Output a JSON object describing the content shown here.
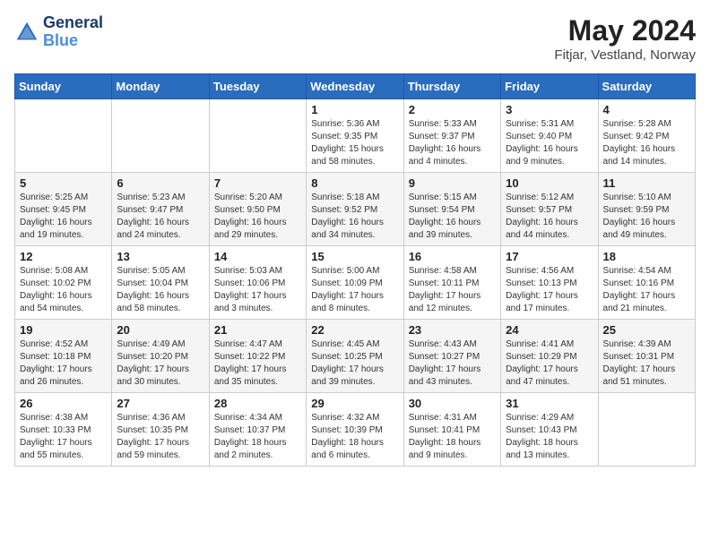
{
  "header": {
    "logo_line1": "General",
    "logo_line2": "Blue",
    "month_year": "May 2024",
    "location": "Fitjar, Vestland, Norway"
  },
  "weekdays": [
    "Sunday",
    "Monday",
    "Tuesday",
    "Wednesday",
    "Thursday",
    "Friday",
    "Saturday"
  ],
  "weeks": [
    [
      {
        "day": "",
        "info": ""
      },
      {
        "day": "",
        "info": ""
      },
      {
        "day": "",
        "info": ""
      },
      {
        "day": "1",
        "info": "Sunrise: 5:36 AM\nSunset: 9:35 PM\nDaylight: 15 hours\nand 58 minutes."
      },
      {
        "day": "2",
        "info": "Sunrise: 5:33 AM\nSunset: 9:37 PM\nDaylight: 16 hours\nand 4 minutes."
      },
      {
        "day": "3",
        "info": "Sunrise: 5:31 AM\nSunset: 9:40 PM\nDaylight: 16 hours\nand 9 minutes."
      },
      {
        "day": "4",
        "info": "Sunrise: 5:28 AM\nSunset: 9:42 PM\nDaylight: 16 hours\nand 14 minutes."
      }
    ],
    [
      {
        "day": "5",
        "info": "Sunrise: 5:25 AM\nSunset: 9:45 PM\nDaylight: 16 hours\nand 19 minutes."
      },
      {
        "day": "6",
        "info": "Sunrise: 5:23 AM\nSunset: 9:47 PM\nDaylight: 16 hours\nand 24 minutes."
      },
      {
        "day": "7",
        "info": "Sunrise: 5:20 AM\nSunset: 9:50 PM\nDaylight: 16 hours\nand 29 minutes."
      },
      {
        "day": "8",
        "info": "Sunrise: 5:18 AM\nSunset: 9:52 PM\nDaylight: 16 hours\nand 34 minutes."
      },
      {
        "day": "9",
        "info": "Sunrise: 5:15 AM\nSunset: 9:54 PM\nDaylight: 16 hours\nand 39 minutes."
      },
      {
        "day": "10",
        "info": "Sunrise: 5:12 AM\nSunset: 9:57 PM\nDaylight: 16 hours\nand 44 minutes."
      },
      {
        "day": "11",
        "info": "Sunrise: 5:10 AM\nSunset: 9:59 PM\nDaylight: 16 hours\nand 49 minutes."
      }
    ],
    [
      {
        "day": "12",
        "info": "Sunrise: 5:08 AM\nSunset: 10:02 PM\nDaylight: 16 hours\nand 54 minutes."
      },
      {
        "day": "13",
        "info": "Sunrise: 5:05 AM\nSunset: 10:04 PM\nDaylight: 16 hours\nand 58 minutes."
      },
      {
        "day": "14",
        "info": "Sunrise: 5:03 AM\nSunset: 10:06 PM\nDaylight: 17 hours\nand 3 minutes."
      },
      {
        "day": "15",
        "info": "Sunrise: 5:00 AM\nSunset: 10:09 PM\nDaylight: 17 hours\nand 8 minutes."
      },
      {
        "day": "16",
        "info": "Sunrise: 4:58 AM\nSunset: 10:11 PM\nDaylight: 17 hours\nand 12 minutes."
      },
      {
        "day": "17",
        "info": "Sunrise: 4:56 AM\nSunset: 10:13 PM\nDaylight: 17 hours\nand 17 minutes."
      },
      {
        "day": "18",
        "info": "Sunrise: 4:54 AM\nSunset: 10:16 PM\nDaylight: 17 hours\nand 21 minutes."
      }
    ],
    [
      {
        "day": "19",
        "info": "Sunrise: 4:52 AM\nSunset: 10:18 PM\nDaylight: 17 hours\nand 26 minutes."
      },
      {
        "day": "20",
        "info": "Sunrise: 4:49 AM\nSunset: 10:20 PM\nDaylight: 17 hours\nand 30 minutes."
      },
      {
        "day": "21",
        "info": "Sunrise: 4:47 AM\nSunset: 10:22 PM\nDaylight: 17 hours\nand 35 minutes."
      },
      {
        "day": "22",
        "info": "Sunrise: 4:45 AM\nSunset: 10:25 PM\nDaylight: 17 hours\nand 39 minutes."
      },
      {
        "day": "23",
        "info": "Sunrise: 4:43 AM\nSunset: 10:27 PM\nDaylight: 17 hours\nand 43 minutes."
      },
      {
        "day": "24",
        "info": "Sunrise: 4:41 AM\nSunset: 10:29 PM\nDaylight: 17 hours\nand 47 minutes."
      },
      {
        "day": "25",
        "info": "Sunrise: 4:39 AM\nSunset: 10:31 PM\nDaylight: 17 hours\nand 51 minutes."
      }
    ],
    [
      {
        "day": "26",
        "info": "Sunrise: 4:38 AM\nSunset: 10:33 PM\nDaylight: 17 hours\nand 55 minutes."
      },
      {
        "day": "27",
        "info": "Sunrise: 4:36 AM\nSunset: 10:35 PM\nDaylight: 17 hours\nand 59 minutes."
      },
      {
        "day": "28",
        "info": "Sunrise: 4:34 AM\nSunset: 10:37 PM\nDaylight: 18 hours\nand 2 minutes."
      },
      {
        "day": "29",
        "info": "Sunrise: 4:32 AM\nSunset: 10:39 PM\nDaylight: 18 hours\nand 6 minutes."
      },
      {
        "day": "30",
        "info": "Sunrise: 4:31 AM\nSunset: 10:41 PM\nDaylight: 18 hours\nand 9 minutes."
      },
      {
        "day": "31",
        "info": "Sunrise: 4:29 AM\nSunset: 10:43 PM\nDaylight: 18 hours\nand 13 minutes."
      },
      {
        "day": "",
        "info": ""
      }
    ]
  ]
}
